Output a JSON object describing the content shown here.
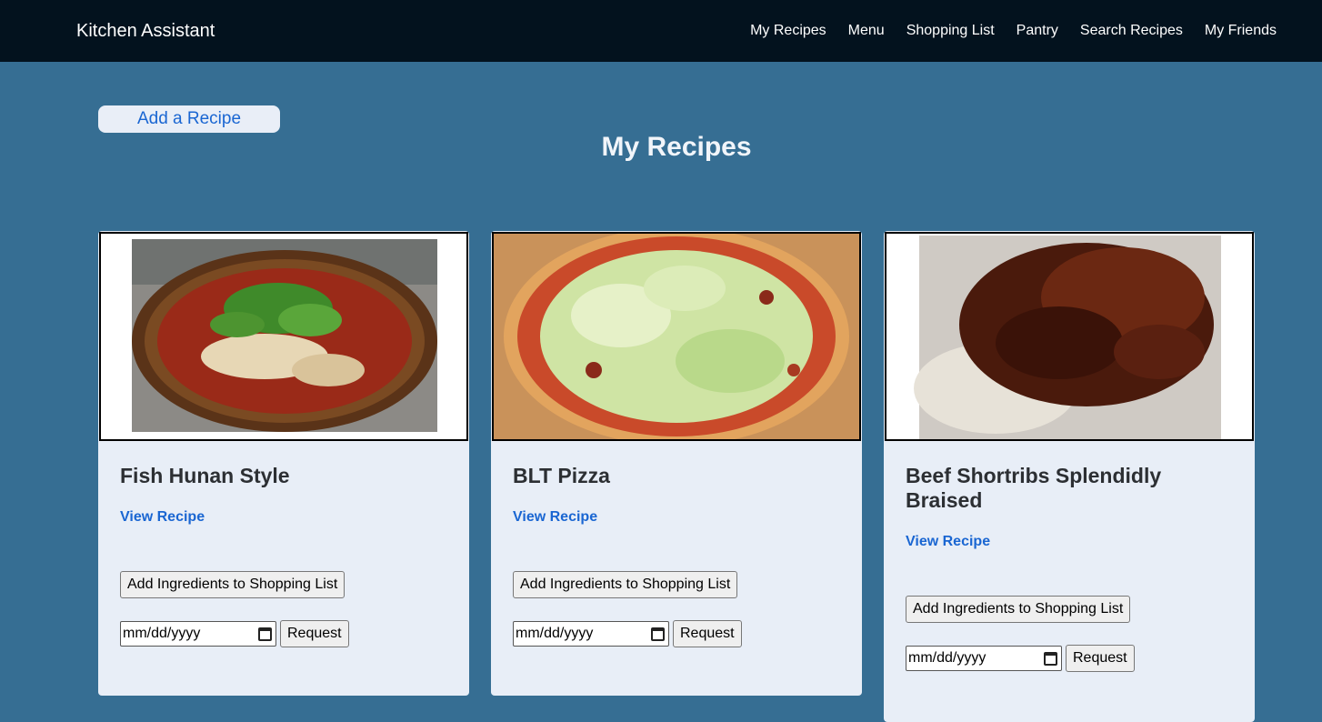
{
  "navbar": {
    "brand": "Kitchen Assistant",
    "links": [
      "My Recipes",
      "Menu",
      "Shopping List",
      "Pantry",
      "Search Recipes",
      "My Friends"
    ]
  },
  "actions": {
    "add_recipe": "Add a Recipe"
  },
  "page": {
    "title": "My Recipes"
  },
  "cards": [
    {
      "title": "Fish Hunan Style",
      "view_link": "View Recipe",
      "add_ingredients": "Add Ingredients to Shopping List",
      "date_placeholder": "mm/dd/yyyy",
      "request": "Request"
    },
    {
      "title": "BLT Pizza",
      "view_link": "View Recipe",
      "add_ingredients": "Add Ingredients to Shopping List",
      "date_placeholder": "mm/dd/yyyy",
      "request": "Request"
    },
    {
      "title": "Beef Shortribs Splendidly Braised",
      "view_link": "View Recipe",
      "add_ingredients": "Add Ingredients to Shopping List",
      "date_placeholder": "mm/dd/yyyy",
      "request": "Request"
    }
  ]
}
